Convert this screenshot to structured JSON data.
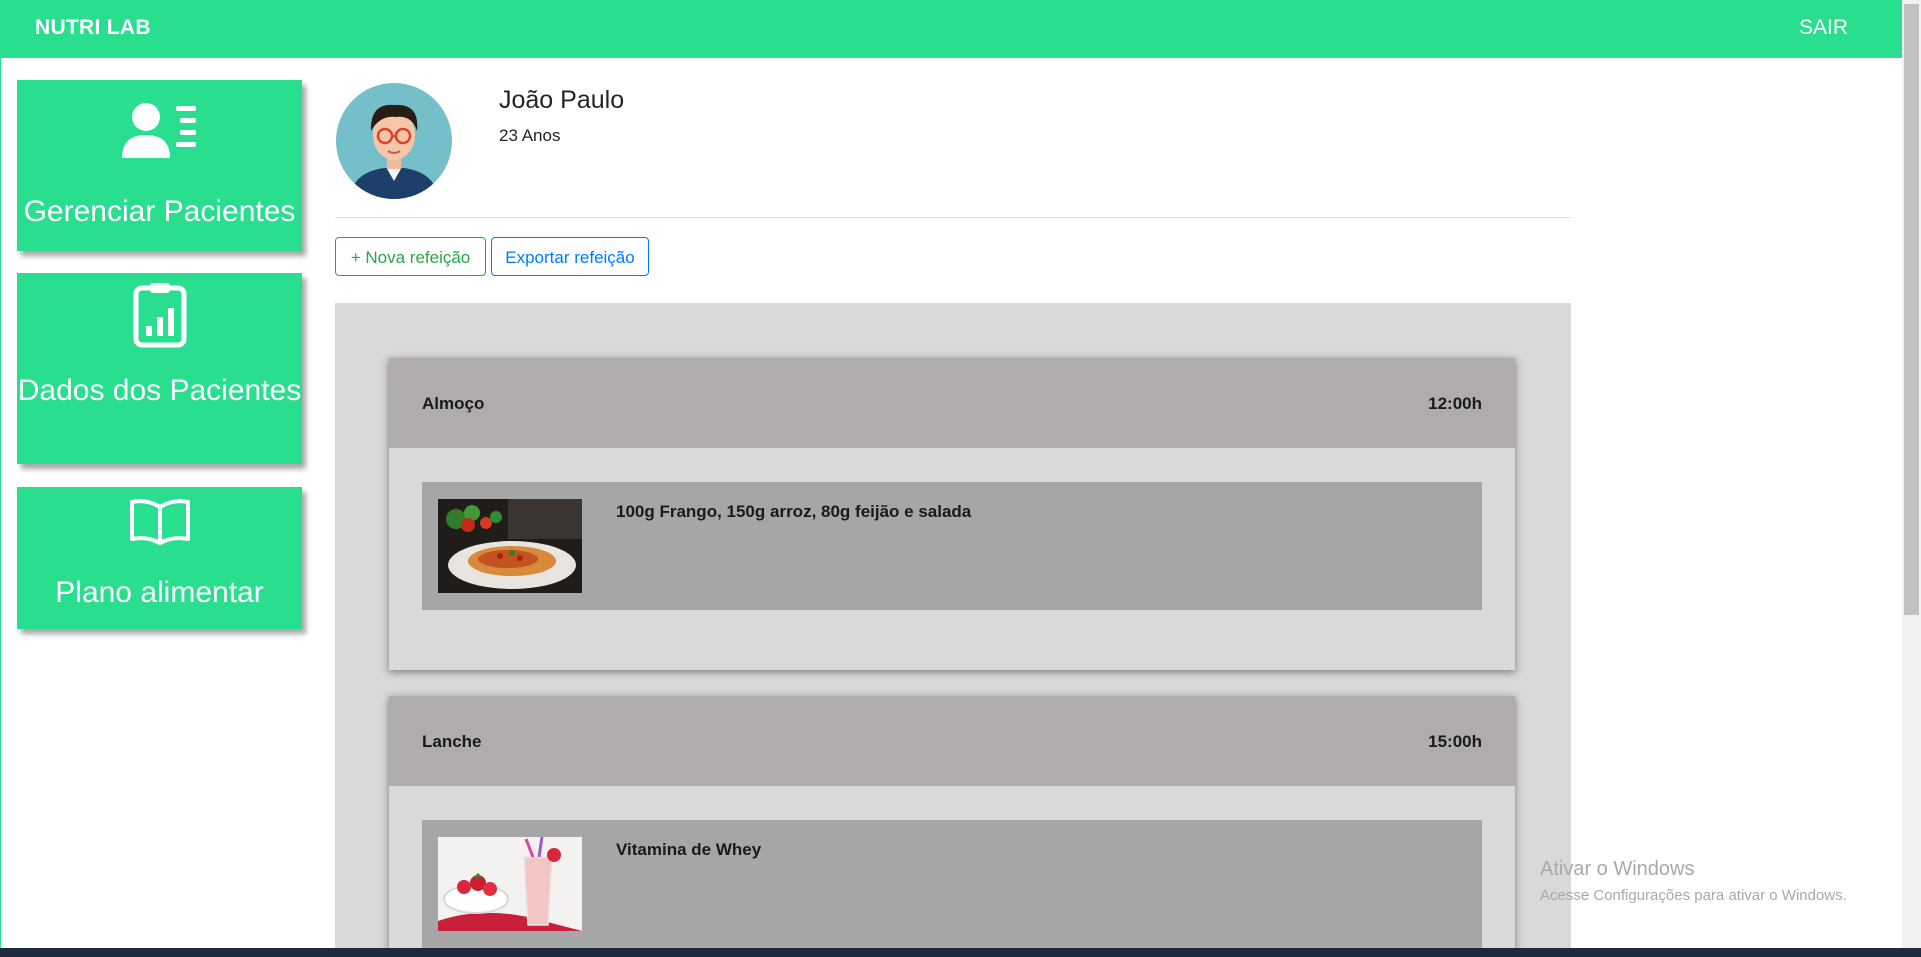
{
  "header": {
    "brand": "NUTRI LAB",
    "logout_label": "SAIR"
  },
  "sidebar": {
    "items": [
      {
        "label": "Gerenciar Pacientes",
        "icon": "user-list-icon"
      },
      {
        "label": "Dados dos Pacientes",
        "icon": "clipboard-chart-icon"
      },
      {
        "label": "Plano alimentar",
        "icon": "open-book-icon"
      }
    ]
  },
  "patient": {
    "name": "João Paulo",
    "age": "23 Anos"
  },
  "actions": {
    "new_meal": "+ Nova refeição",
    "export_meal": "Exportar refeição"
  },
  "meals": [
    {
      "title": "Almoço",
      "time": "12:00h",
      "items": [
        {
          "description": "100g Frango, 150g arroz, 80g feijão e salada",
          "image": "spaghetti-plate-image"
        }
      ]
    },
    {
      "title": "Lanche",
      "time": "15:00h",
      "items": [
        {
          "description": "Vitamina de Whey",
          "image": "strawberry-smoothie-image"
        }
      ]
    }
  ],
  "watermark": {
    "title": "Ativar o Windows",
    "subtitle": "Acesse Configurações para ativar o Windows."
  },
  "colors": {
    "brand": "#2ade8f",
    "meal_header": "#b0acab",
    "meal_item": "#a6a6a6",
    "panel": "#d9d9d9"
  }
}
